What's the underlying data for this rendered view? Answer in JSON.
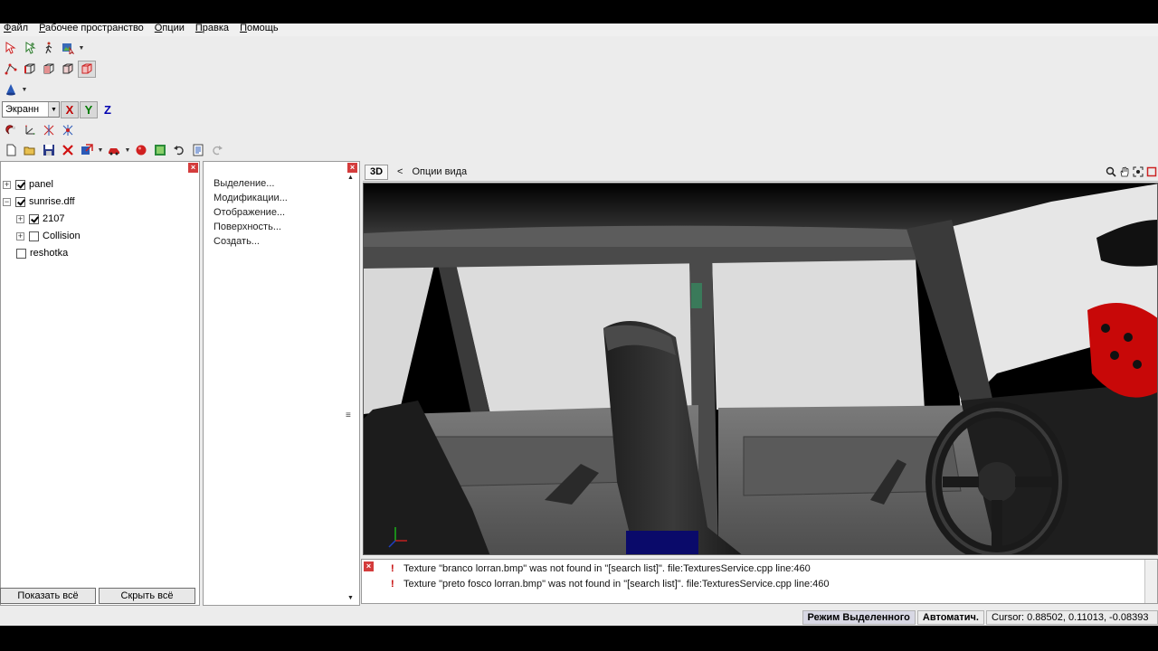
{
  "menu": [
    "Файл",
    "Рабочее пространство",
    "Опции",
    "Правка",
    "Помощь"
  ],
  "toolbar": {
    "coord_mode": "Экранн",
    "axes": [
      "X",
      "Y",
      "Z"
    ],
    "colors": {
      "axis_x": "#c00000",
      "axis_y": "#007a00",
      "axis_z": "#0000b0"
    }
  },
  "scene_tree": {
    "items": [
      {
        "label": "panel",
        "checked": true,
        "expander": "+"
      },
      {
        "label": "sunrise.dff",
        "checked": true,
        "expander": "−"
      },
      {
        "label": "2107",
        "checked": true,
        "expander": "+"
      },
      {
        "label": "Collision",
        "checked": false,
        "expander": "+"
      },
      {
        "label": "reshotka",
        "checked": false,
        "expander": ""
      }
    ],
    "show_all": "Показать всё",
    "hide_all": "Скрыть всё"
  },
  "actions": [
    "Выделение...",
    "Модификации...",
    "Отображение...",
    "Поверхность...",
    "Создать..."
  ],
  "view": {
    "mode": "3D",
    "back_symbol": "<",
    "options_label": "Опции вида"
  },
  "log": [
    "Texture \"branco lorran.bmp\" was not found in \"[search list]\". file:TexturesService.cpp line:460",
    "Texture \"preto fosco lorran.bmp\" was not found in \"[search list]\". file:TexturesService.cpp line:460"
  ],
  "status": {
    "mode": "Режим Выделенного",
    "snap": "Автоматич.",
    "cursor": "Cursor: 0.88502, 0.11013, -0.08393"
  }
}
